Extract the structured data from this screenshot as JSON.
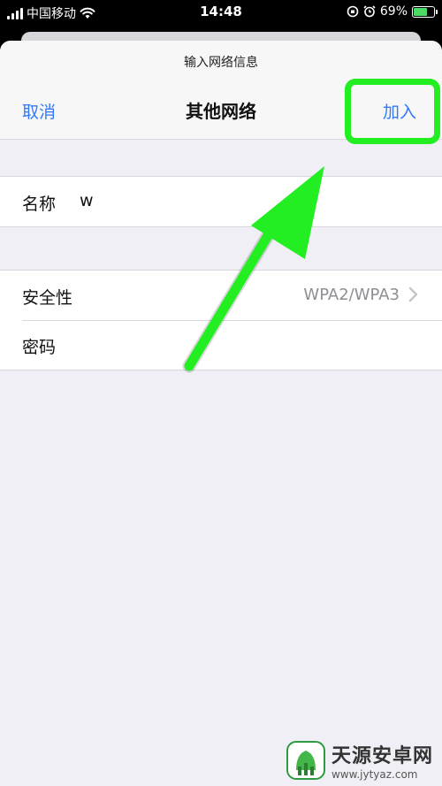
{
  "status_bar": {
    "carrier": "中国移动",
    "time": "14:48",
    "battery_percent": "69%",
    "battery_level": 0.69,
    "battery_color": "#4cd964",
    "icons": [
      "signal-bars-icon",
      "wifi-icon",
      "orientation-lock-icon",
      "alarm-icon",
      "battery-charging-icon"
    ]
  },
  "sheet": {
    "prompt": "输入网络信息",
    "title": "其他网络",
    "cancel_label": "取消",
    "join_label": "加入",
    "accent_color": "#3478f6"
  },
  "form": {
    "name": {
      "label": "名称",
      "value": "w"
    },
    "security": {
      "label": "安全性",
      "value": "WPA2/WPA3"
    },
    "password": {
      "label": "密码",
      "value": ""
    }
  },
  "annotation": {
    "highlight_color": "#22ee22",
    "icons": [
      "highlight-box",
      "pointer-arrow-icon"
    ]
  },
  "watermark": {
    "name": "天源安卓网",
    "url": "www.jytyaz.com"
  }
}
